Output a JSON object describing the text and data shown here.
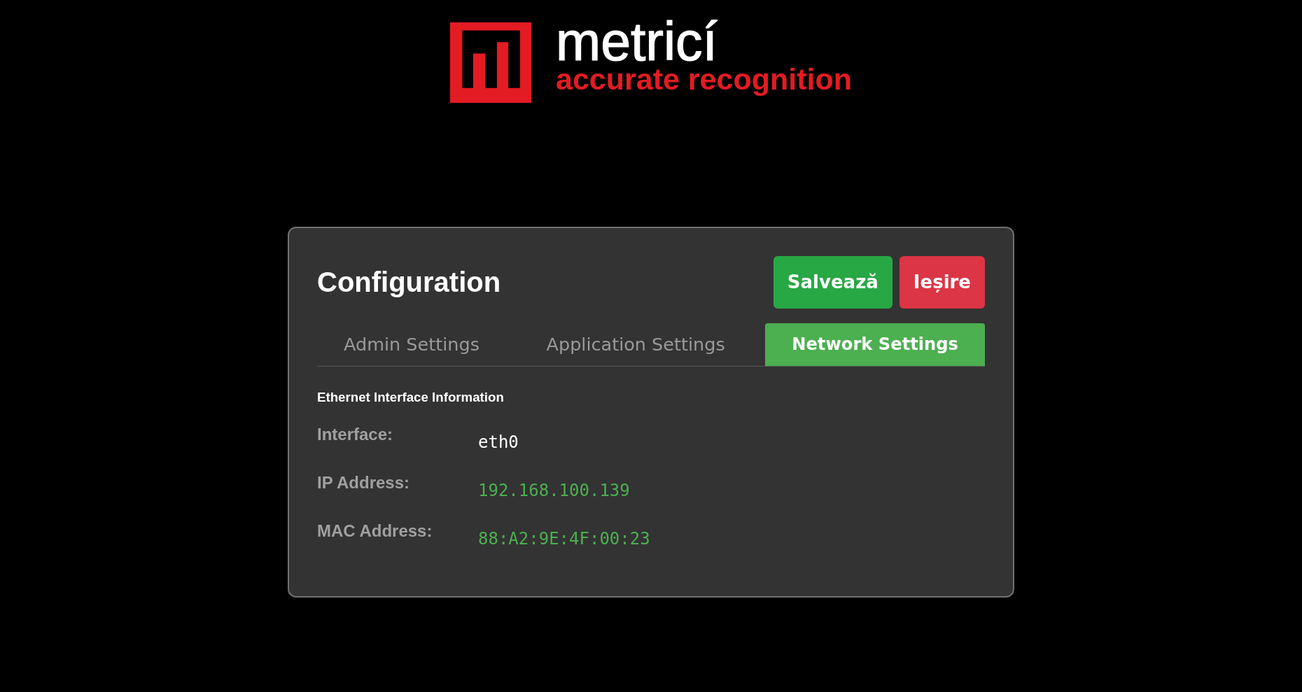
{
  "logo": {
    "name": "metricí",
    "tagline": "accurate recognition"
  },
  "header": {
    "title": "Configuration",
    "buttons": [
      {
        "label": "Salvează",
        "kind": "save"
      },
      {
        "label": "Ieșire",
        "kind": "exit"
      }
    ]
  },
  "tabs": [
    {
      "label": "Admin Settings",
      "selected": false
    },
    {
      "label": "Application Settings",
      "selected": false
    },
    {
      "label": "Network Settings",
      "selected": true
    }
  ],
  "section": {
    "title": "Ethernet Interface Information",
    "rows": [
      {
        "label": "Interface:",
        "value": "eth0",
        "color": "#ffffff"
      },
      {
        "label": "IP Address:",
        "value": "192.168.100.139",
        "color": "#4caf50"
      },
      {
        "label": "MAC Address:",
        "value": "88:A2:9E:4F:00:23",
        "color": "#4caf50"
      }
    ]
  }
}
